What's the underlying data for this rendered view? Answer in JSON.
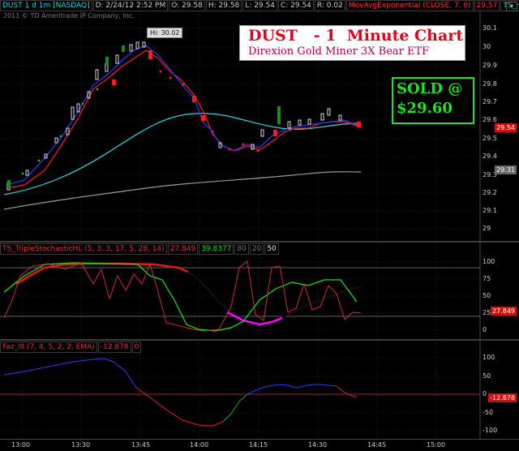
{
  "header": {
    "symbol": "DUST 1 d 1m [NASDAQ]",
    "date": "D: 2/24/12 2:52 PM",
    "open": "O: 29.58",
    "high": "H: 29.58",
    "low": "L: 29.54",
    "close": "C: 29.54",
    "range": "R: 0.02",
    "mov_avg": "MovAvgExponential (CLOSE, 7, 0)",
    "mov_avg_value": "29.57",
    "ts_label": "TS_H..."
  },
  "copyright": "2011 © TD Ameritrade IP Company, Inc.",
  "hi_label": "Hi: 30.02",
  "annotation": {
    "title": "DUST   - 1  Minute Chart",
    "subtitle": "Direxion Gold Miner 3X Bear ETF",
    "sold_line1": "SOLD @",
    "sold_line2": "$29.60"
  },
  "price_axis": {
    "ticks": [
      "30.1",
      "30",
      "29.9",
      "29.8",
      "29.7",
      "29.6",
      "29.5",
      "29.4",
      "29.3",
      "29.2",
      "29.1",
      "29"
    ],
    "badge_last": "29.54",
    "badge_ma": "29.31"
  },
  "stoch_pane": {
    "label": "TS_TripleStochasticHL (5, 3, 3, 17, 5, 28, 14)",
    "value1": "27.849",
    "value2": "39.8377",
    "tab_80": "80",
    "tab_20": "20",
    "tab_50": "50",
    "ticks": [
      "100",
      "75",
      "50",
      "25",
      "0"
    ],
    "badge": "27.849"
  },
  "faz_pane": {
    "label": "Faz_III (7, 4, 5, 2, 2, EMA)",
    "value": "-12.878",
    "value2": "0",
    "ticks": [
      "100",
      "50",
      "0",
      "-50",
      "-100"
    ],
    "badge": "-12.878"
  },
  "time_axis": [
    "13:00",
    "13:30",
    "13:45",
    "14:00",
    "14:15",
    "14:30",
    "14:45",
    "15:00"
  ],
  "colors": {
    "price_blue": "#2b3bff",
    "price_red": "#ff1b1b",
    "ema_cyan": "#33d6e6",
    "ma_gray": "#9a9a9a",
    "stoch_green": "#19e619",
    "stoch_black": "#101010",
    "stoch_magenta": "#ff00ff",
    "sold_green": "#21e421",
    "title_red": "#e0001b",
    "subtitle_red": "#b0003f"
  }
}
